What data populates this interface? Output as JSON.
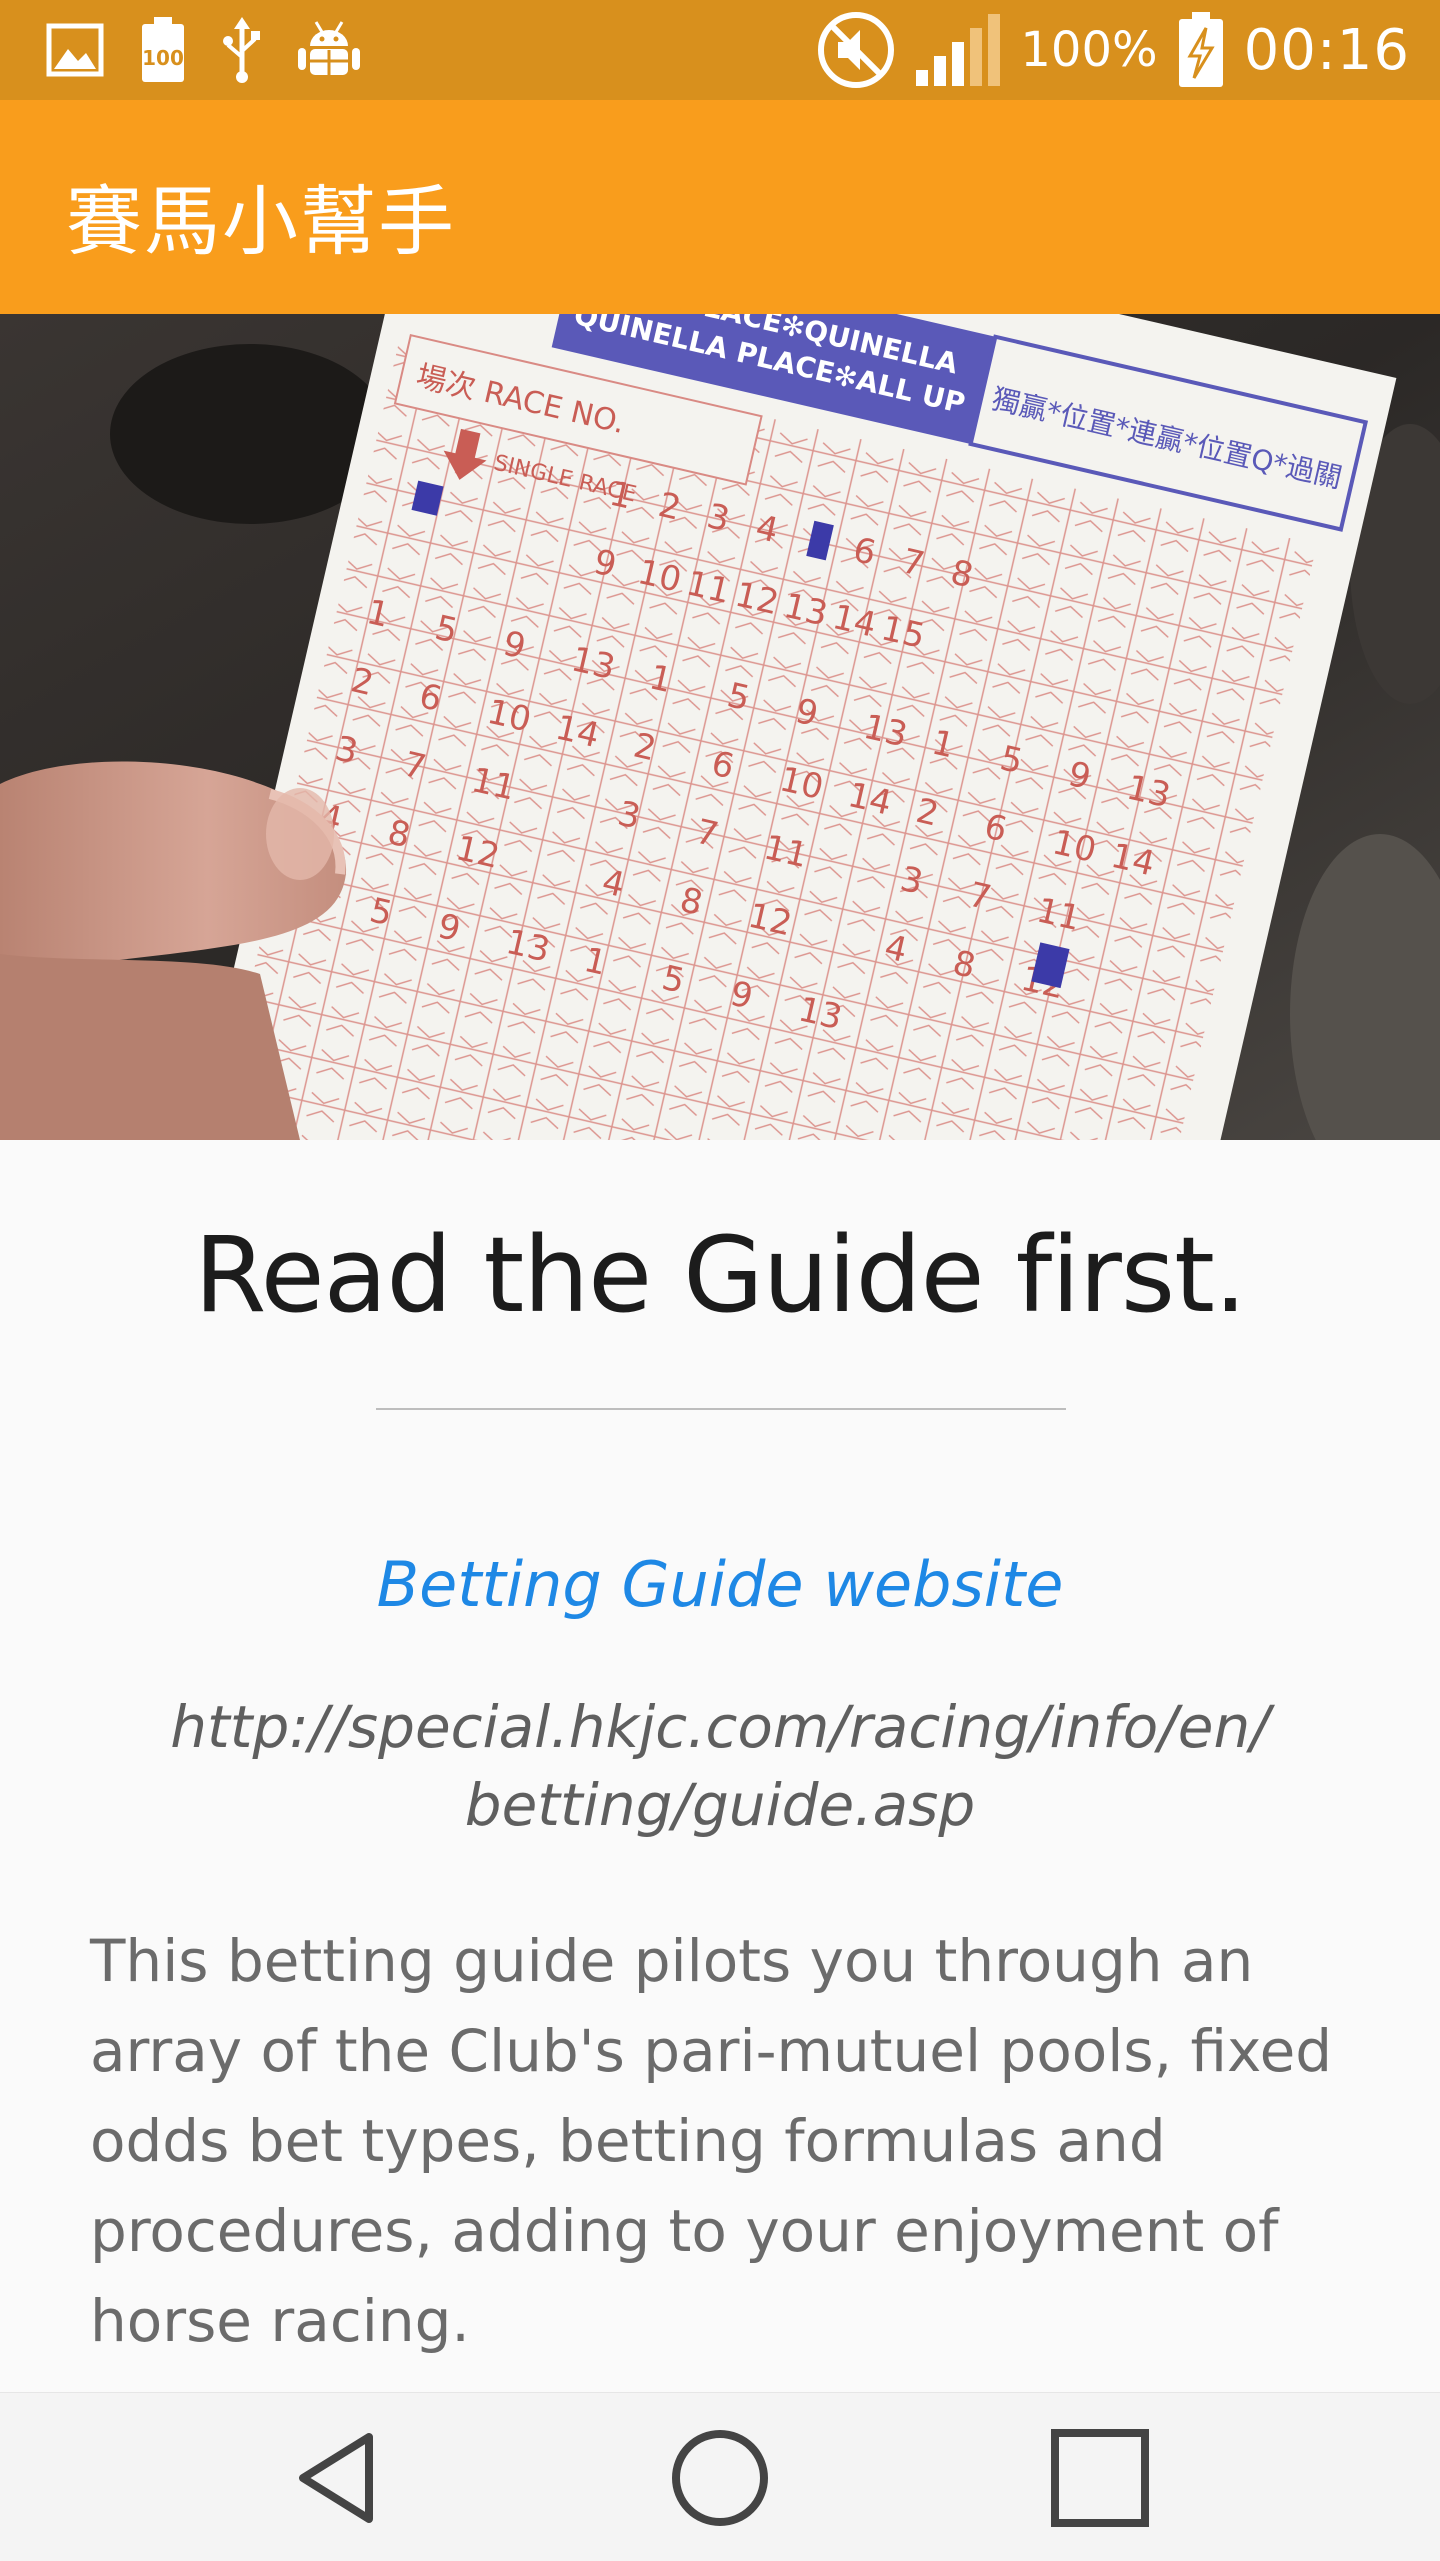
{
  "status_bar": {
    "battery_percent": "100%",
    "time": "00:16",
    "left_icons": [
      "gallery-icon",
      "battery-saver-icon",
      "usb-icon",
      "android-debug-icon"
    ],
    "right_icons": [
      "mute-icon",
      "signal-icon",
      "battery-charging-icon"
    ]
  },
  "app_bar": {
    "title": "賽馬小幫手"
  },
  "hero": {
    "image_subject": "betting-slip-photo",
    "slip": {
      "header_line1": "WIN✻PLACE✻QUINELLA",
      "header_line2": "QUINELLA PLACE✻ALL UP",
      "chinese_header": "獨贏*位置*連贏*位置Q*過關",
      "race_no_label": "場次 RACE NO.",
      "single_race_label": "SINGLE RACE"
    }
  },
  "content": {
    "headline": "Read the Guide first.",
    "link_label": "Betting Guide website",
    "url": "http://special.hkjc.com/racing/info/en/betting/guide.asp",
    "description": "This betting guide pilots you through an array of the Club's pari-mutuel pools, fixed odds bet types, betting formulas and procedures, adding to your enjoyment of horse racing."
  },
  "nav_bar": {
    "buttons": [
      "back-icon",
      "home-icon",
      "recents-icon"
    ]
  },
  "colors": {
    "status_bar": "#d8901d",
    "app_bar": "#f99d1c",
    "link": "#1e88e5",
    "headline": "#1c1c1c",
    "body_text": "#6b6b6b"
  }
}
